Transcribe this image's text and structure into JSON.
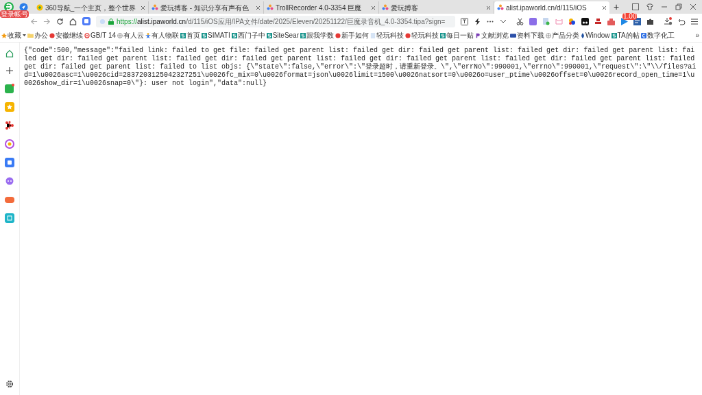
{
  "browser": {
    "account_badge": "登录帐号",
    "tabs": [
      {
        "title": "360导航_一个主页，整个世界",
        "selected": false
      },
      {
        "title": "爱玩搏客 - 知识分享有声有色",
        "selected": false
      },
      {
        "title": "TrollRecorder 4.0-3354 巨魔",
        "selected": false
      },
      {
        "title": "爱玩搏客",
        "selected": false
      },
      {
        "title": "alist.ipaworld.cn/d/115/iOS",
        "selected": true
      }
    ],
    "new_tab": "+",
    "address": {
      "scheme": "https://",
      "host": "alist.ipaworld.cn",
      "path": "/d/115/iOS应用/IPA文件/date/2025/Eleven/20251122/巨魔录音机_4.0-3354.tipa?sign="
    },
    "extension_badge": "1.00",
    "bookmarks": [
      {
        "label": "收藏"
      },
      {
        "label": "办公"
      },
      {
        "label": "安徽继续"
      },
      {
        "label": "GB/T 14"
      },
      {
        "label": "有人云"
      },
      {
        "label": "有人物联"
      },
      {
        "label": "首页"
      },
      {
        "label": "SIMATI"
      },
      {
        "label": "西门子中"
      },
      {
        "label": "SiteSear"
      },
      {
        "label": "跟我学数"
      },
      {
        "label": "新手如何"
      },
      {
        "label": "轻玩科技"
      },
      {
        "label": "轻玩科技"
      },
      {
        "label": "每日一贴"
      },
      {
        "label": "文献浏览"
      },
      {
        "label": "资料下载"
      },
      {
        "label": "产品分类"
      },
      {
        "label": "Window"
      },
      {
        "label": "TA的帖"
      },
      {
        "label": "数字化工"
      }
    ],
    "bookmarks_more": "»"
  },
  "page": {
    "text": "{\"code\":500,\"message\":\"failed link: failed to get file: failed get parent list: failed get dir: failed get parent list: failed get dir: failed get parent list: failed get dir: failed get parent list: failed get dir: failed get parent list: failed get dir: failed get parent list: failed get dir: failed get parent list: failed get dir: failed get parent list: failed to list objs: {\\\"state\\\":false,\\\"error\\\":\\\"登录超时，请重新登录。\\\",\\\"errNo\\\":990001,\\\"errno\\\":990001,\\\"request\\\":\\\"\\\\/files?aid=1\\u0026asc=1\\u0026cid=2837203125042327251\\u0026fc_mix=0\\u0026format=json\\u0026limit=1500\\u0026natsort=0\\u0026o=user_ptime\\u0026offset=0\\u0026record_open_time=1\\u0026show_dir=1\\u0026snap=0\\\"}: user not login\",\"data\":null}"
  }
}
